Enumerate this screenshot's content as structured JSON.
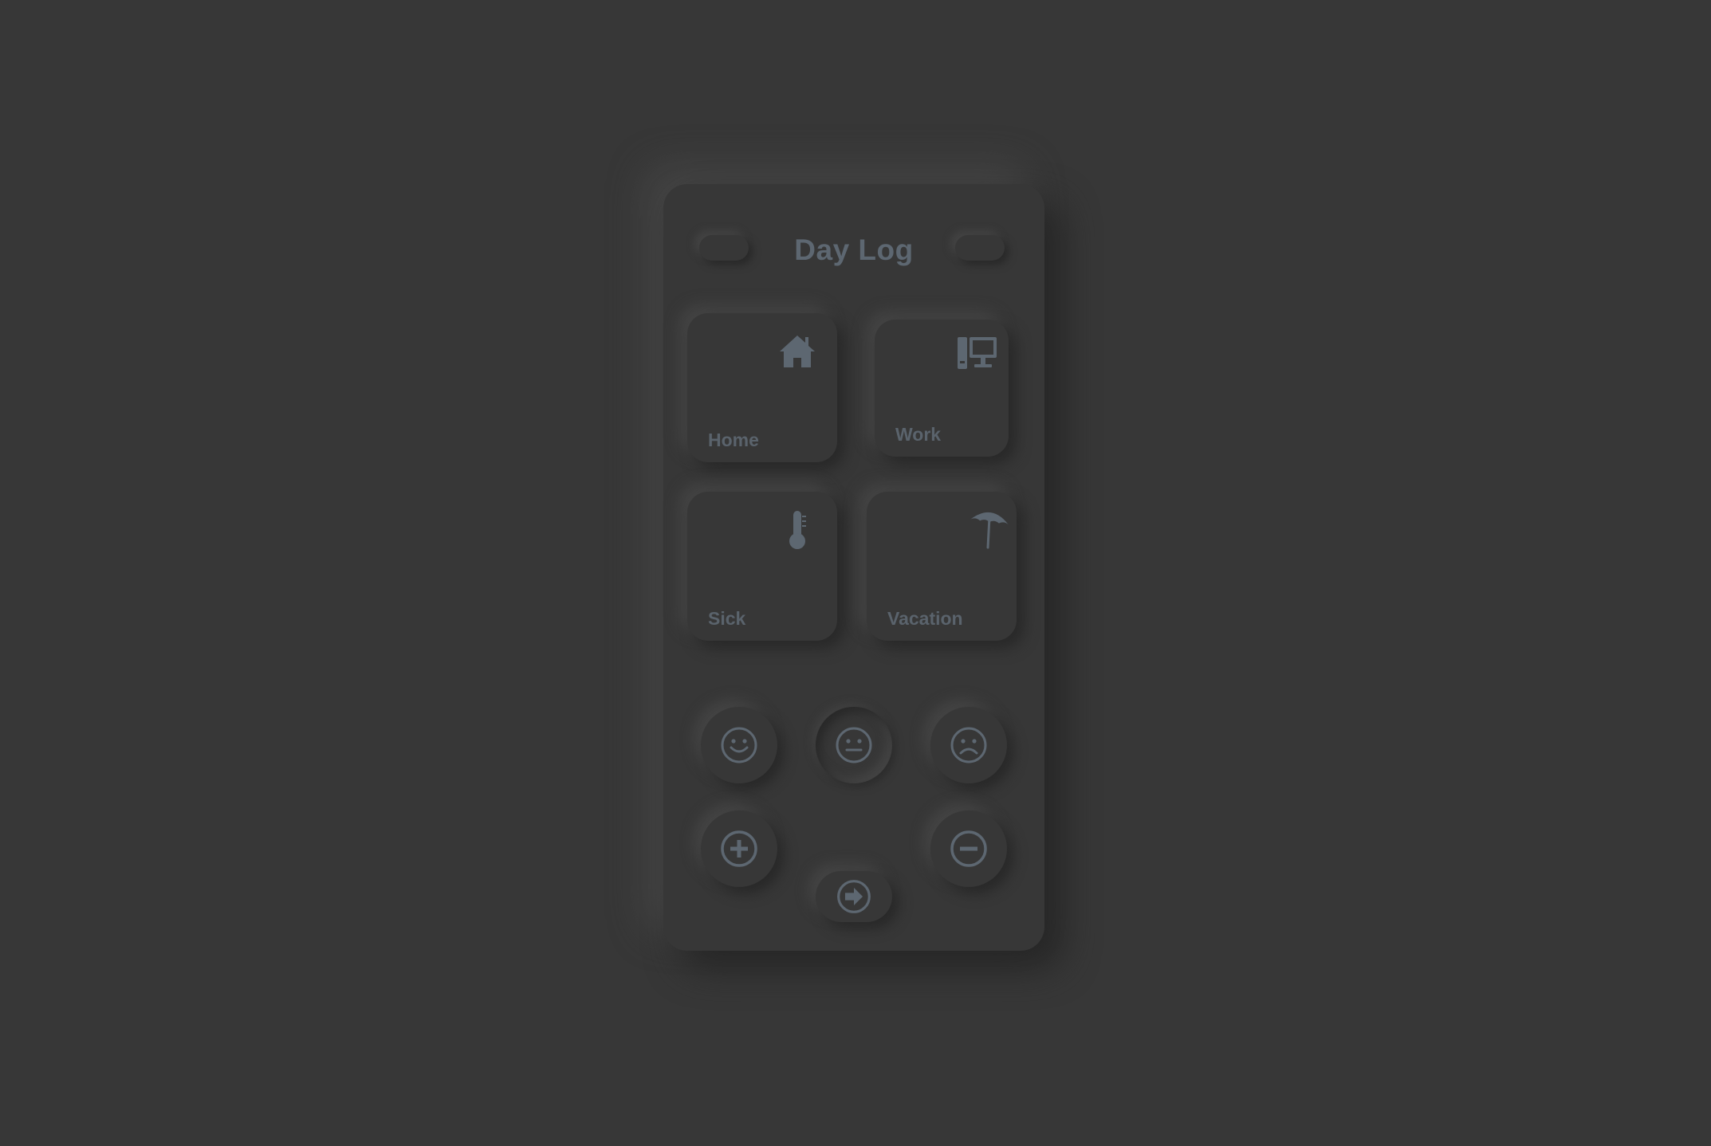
{
  "app": {
    "title": "Day Log"
  },
  "categories": [
    {
      "label": "Home",
      "icon": "home-icon"
    },
    {
      "label": "Work",
      "icon": "computer-icon"
    },
    {
      "label": "Sick",
      "icon": "thermometer-icon"
    },
    {
      "label": "Vacation",
      "icon": "umbrella-icon"
    }
  ],
  "mood": {
    "options": [
      "smile-icon",
      "neutral-face-icon",
      "sad-face-icon"
    ],
    "selected": "neutral-face-icon"
  },
  "actions": {
    "add_icon": "plus-circle-icon",
    "remove_icon": "minus-circle-icon",
    "next_icon": "arrow-right-circle-icon"
  },
  "colors": {
    "background": "#373737",
    "icon": "#5d6771",
    "text": "#5a636c"
  }
}
